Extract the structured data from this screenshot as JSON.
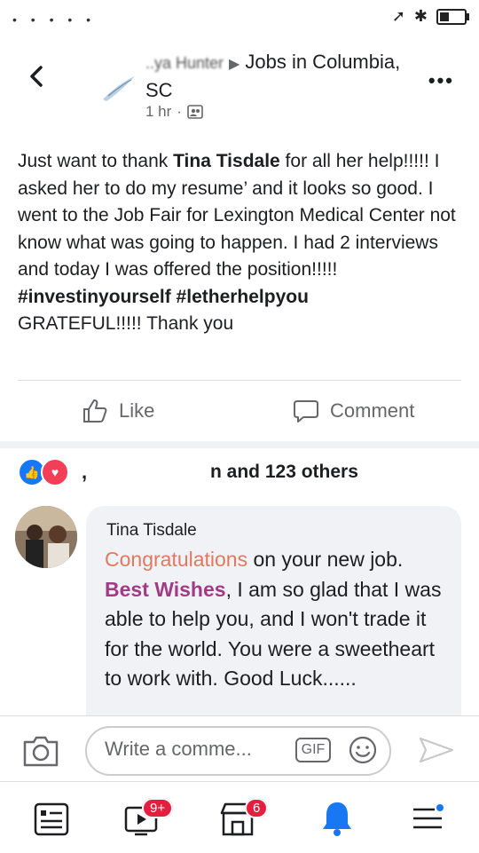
{
  "status": {
    "icons": [
      "location-arrow-icon",
      "bluetooth-icon",
      "battery-icon"
    ]
  },
  "header": {
    "author_blurred": "..ya Hunter",
    "group": "Jobs in Columbia, SC",
    "time": "1 hr",
    "privacy_icon": "group-privacy-icon"
  },
  "post": {
    "pre1": "Just want to thank ",
    "bold_name": "Tina Tisdale",
    "rest": " for all her help!!!!! I asked her to do my resume’ and it looks so good. I went to the Job Fair for Lexington Medical Center not know what was going to happen. I had 2 interviews and today I was offered the position!!!!!",
    "hashtags": "#investinyourself #letherhelpyou",
    "closing": "GRATEFUL!!!!! Thank you"
  },
  "actions": {
    "like": "Like",
    "comment": "Comment"
  },
  "reactions": {
    "text": "n and 123 others"
  },
  "comment": {
    "author": "Tina Tisdale",
    "part1": "Congratulations",
    "part2": " on your new job. ",
    "part3": "Best Wishes",
    "part4": ", I am so glad that I was able to help you, and I won't trade it for the world. You were a sweetheart to work with. Good Luck......"
  },
  "composer": {
    "placeholder": "Write a comme...",
    "gif": "GIF"
  },
  "nav": {
    "badges": {
      "video": "9+",
      "marketplace": "6"
    },
    "notification_color": "#1877f2"
  },
  "colors": {
    "accent": "#1877f2",
    "highlight_orange": "#e07a5f",
    "highlight_purple": "#a23b86"
  }
}
